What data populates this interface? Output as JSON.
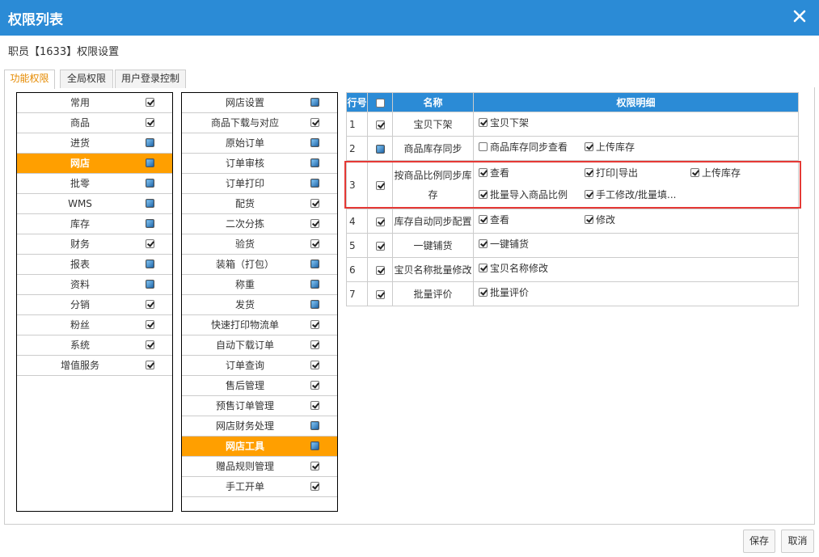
{
  "dialog": {
    "title": "权限列表",
    "subtitle": "职员【1633】权限设置"
  },
  "tabs": [
    {
      "label": "功能权限",
      "active": true
    },
    {
      "label": "全局权限",
      "active": false
    },
    {
      "label": "用户登录控制",
      "active": false
    }
  ],
  "modules": [
    {
      "label": "常用",
      "state": "checked"
    },
    {
      "label": "商品",
      "state": "checked"
    },
    {
      "label": "进货",
      "state": "partial"
    },
    {
      "label": "网店",
      "state": "partial",
      "selected": true
    },
    {
      "label": "批零",
      "state": "partial"
    },
    {
      "label": "WMS",
      "state": "partial"
    },
    {
      "label": "库存",
      "state": "partial"
    },
    {
      "label": "财务",
      "state": "checked"
    },
    {
      "label": "报表",
      "state": "partial"
    },
    {
      "label": "资料",
      "state": "partial"
    },
    {
      "label": "分销",
      "state": "checked"
    },
    {
      "label": "粉丝",
      "state": "checked"
    },
    {
      "label": "系统",
      "state": "checked"
    },
    {
      "label": "增值服务",
      "state": "checked"
    }
  ],
  "submodules": [
    {
      "label": "网店设置",
      "state": "partial"
    },
    {
      "label": "商品下载与对应",
      "state": "checked"
    },
    {
      "label": "原始订单",
      "state": "partial"
    },
    {
      "label": "订单审核",
      "state": "partial"
    },
    {
      "label": "订单打印",
      "state": "partial"
    },
    {
      "label": "配货",
      "state": "checked"
    },
    {
      "label": "二次分拣",
      "state": "checked"
    },
    {
      "label": "验货",
      "state": "checked"
    },
    {
      "label": "装箱（打包）",
      "state": "partial"
    },
    {
      "label": "称重",
      "state": "partial"
    },
    {
      "label": "发货",
      "state": "partial"
    },
    {
      "label": "快速打印物流单",
      "state": "checked"
    },
    {
      "label": "自动下载订单",
      "state": "checked"
    },
    {
      "label": "订单查询",
      "state": "checked"
    },
    {
      "label": "售后管理",
      "state": "checked"
    },
    {
      "label": "预售订单管理",
      "state": "checked"
    },
    {
      "label": "网店财务处理",
      "state": "partial"
    },
    {
      "label": "网店工具",
      "state": "partial",
      "selected": true
    },
    {
      "label": "赠品规则管理",
      "state": "checked"
    },
    {
      "label": "手工开单",
      "state": "checked"
    }
  ],
  "table": {
    "headers": {
      "no": "行号",
      "name": "名称",
      "detail": "权限明细"
    },
    "rows": [
      {
        "no": "1",
        "state": "checked",
        "name": "宝贝下架",
        "items": [
          {
            "label": "宝贝下架",
            "checked": true
          }
        ]
      },
      {
        "no": "2",
        "state": "partial",
        "name": "商品库存同步",
        "items": [
          {
            "label": "商品库存同步查看",
            "checked": false
          },
          {
            "label": "上传库存",
            "checked": true
          }
        ]
      },
      {
        "no": "3",
        "state": "checked",
        "name": "按商品比例同步库存",
        "items": [
          {
            "label": "查看",
            "checked": true
          },
          {
            "label": "打印|导出",
            "checked": true
          },
          {
            "label": "上传库存",
            "checked": true
          },
          {
            "label": "批量导入商品比例",
            "checked": true
          },
          {
            "label": "手工修改/批量填...",
            "checked": true
          }
        ]
      },
      {
        "no": "4",
        "state": "checked",
        "name": "库存自动同步配置",
        "items": [
          {
            "label": "查看",
            "checked": true
          },
          {
            "label": "修改",
            "checked": true
          }
        ]
      },
      {
        "no": "5",
        "state": "checked",
        "name": "一键铺货",
        "items": [
          {
            "label": "一键铺货",
            "checked": true
          }
        ]
      },
      {
        "no": "6",
        "state": "checked",
        "name": "宝贝名称批量修改",
        "items": [
          {
            "label": "宝贝名称修改",
            "checked": true
          }
        ]
      },
      {
        "no": "7",
        "state": "checked",
        "name": "批量评价",
        "items": [
          {
            "label": "批量评价",
            "checked": true
          }
        ]
      }
    ]
  },
  "buttons": {
    "save": "保存",
    "cancel": "取消"
  },
  "colors": {
    "header_blue": "#2b8bd6",
    "selected_orange": "#ff9f00",
    "highlight_red": "#e53935",
    "tab_active_text": "#e58a00"
  }
}
